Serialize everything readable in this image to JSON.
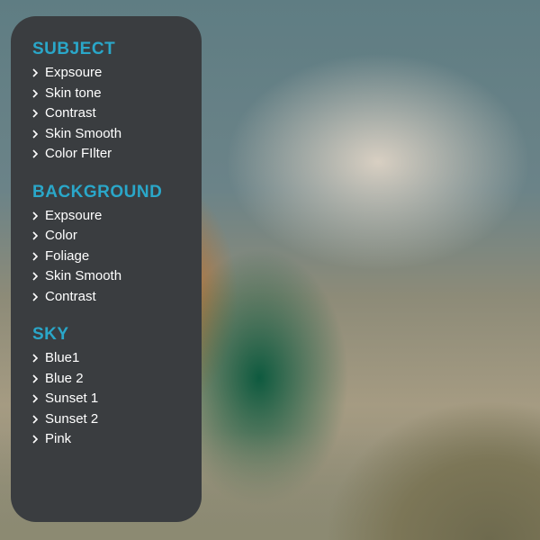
{
  "colors": {
    "panel_bg": "#3a3d40",
    "heading": "#2aa7c9",
    "item_text": "#ffffff"
  },
  "sections": [
    {
      "title": "SUBJECT",
      "items": [
        "Expsoure",
        "Skin tone",
        "Contrast",
        "Skin Smooth",
        "Color FIlter"
      ]
    },
    {
      "title": "BACKGROUND",
      "items": [
        "Expsoure",
        "Color",
        "Foliage",
        "Skin Smooth",
        "Contrast"
      ]
    },
    {
      "title": "SKY",
      "items": [
        "Blue1",
        "Blue 2",
        "Sunset 1",
        "Sunset 2",
        "Pink"
      ]
    }
  ]
}
